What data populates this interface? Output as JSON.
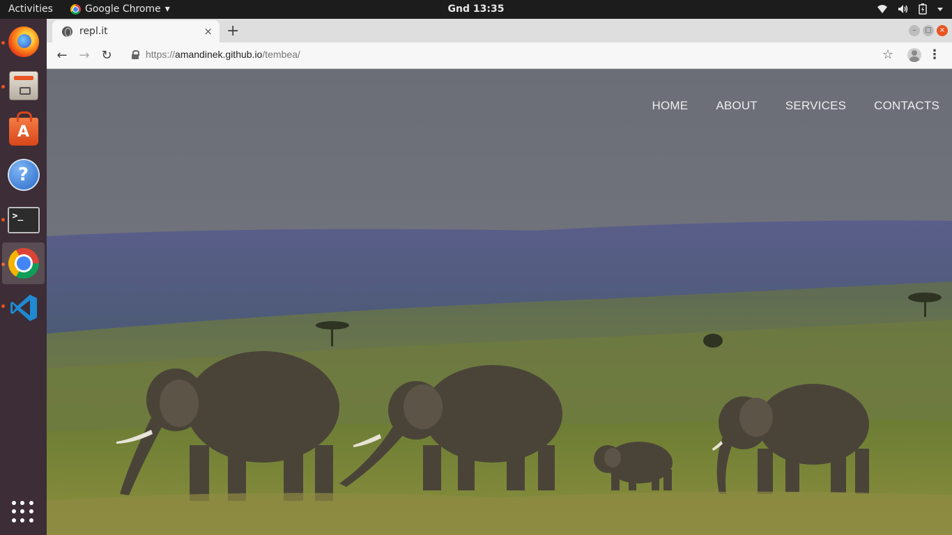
{
  "topbar": {
    "activities": "Activities",
    "app_name": "Google Chrome",
    "app_menu_arrow": "▾",
    "clock": "Gnd 13:35",
    "status_icons": [
      "wifi-icon",
      "volume-icon",
      "battery-icon",
      "system-menu-icon"
    ]
  },
  "dock": {
    "apps": [
      "firefox",
      "files",
      "ubuntu-software",
      "help",
      "terminal",
      "google-chrome",
      "visual-studio-code"
    ],
    "active_app": "google-chrome",
    "show_apps": "show-applications-grid"
  },
  "browser": {
    "tab_title": "repl.it",
    "tab_close": "×",
    "new_tab": "+",
    "url_scheme": "https://",
    "url_host": "amandinek.github.io",
    "url_path": "/tembea/",
    "back": "←",
    "forward": "→",
    "reload": "↻",
    "bookmark": "☆",
    "menu": "⋮",
    "window_controls": [
      "–",
      "□",
      "×"
    ]
  },
  "site": {
    "nav": [
      "HOME",
      "ABOUT",
      "SERVICES",
      "CONTACTS"
    ],
    "hero_image": "elephants-savanna"
  },
  "colors": {
    "topbar": "#1c1c1c",
    "dock": "#3c2d36",
    "accent": "#e95420",
    "sky": "#6e7078",
    "grass": "#7f8a3c"
  }
}
